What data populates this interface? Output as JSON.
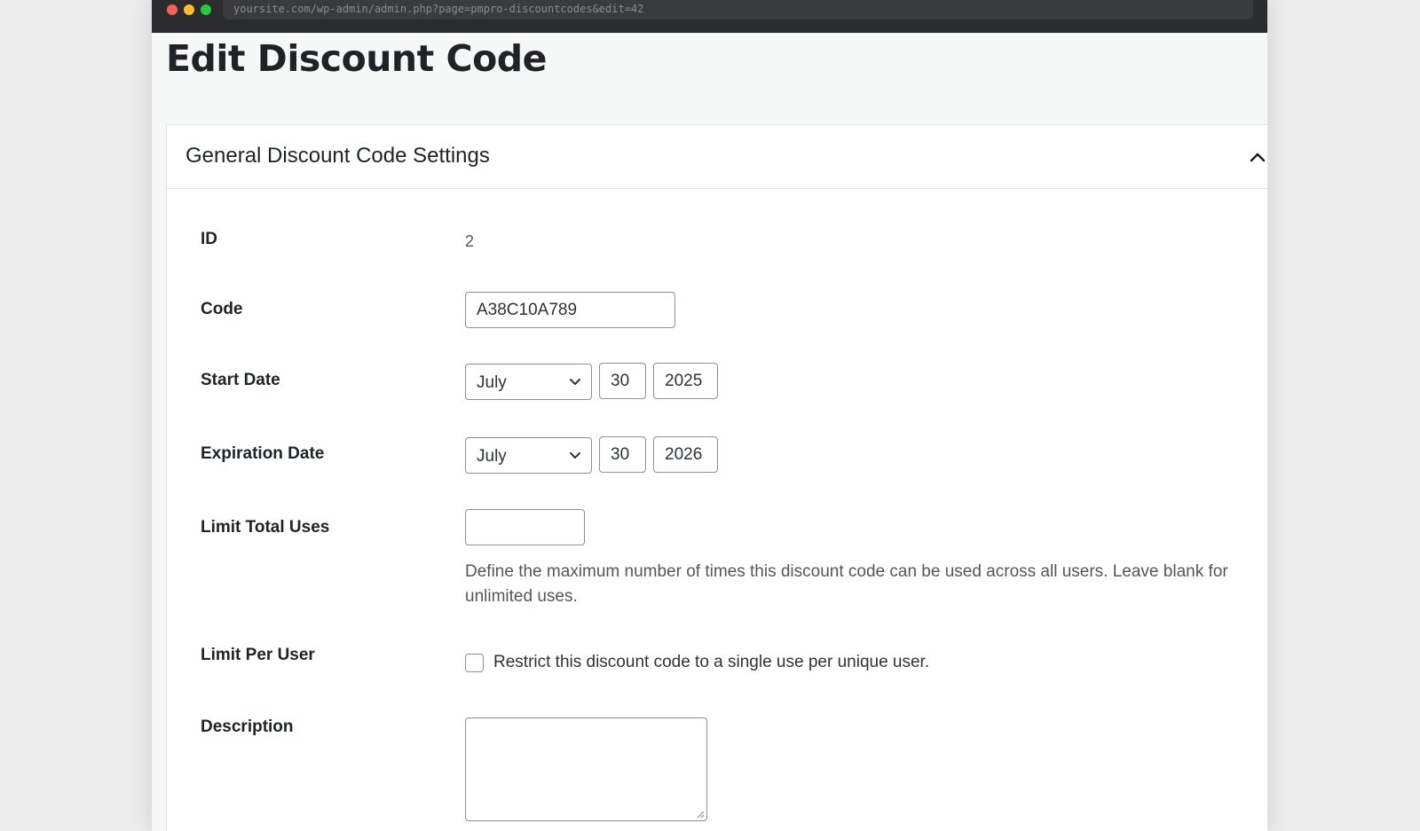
{
  "browser": {
    "url": "yoursite.com/wp-admin/admin.php?page=pmpro-discountcodes&edit=42"
  },
  "page": {
    "title": "Edit Discount Code"
  },
  "panel": {
    "title": "General Discount Code Settings",
    "collapse_icon": "chevron-up-icon"
  },
  "fields": {
    "id": {
      "label": "ID",
      "value": "2"
    },
    "code": {
      "label": "Code",
      "value": "A38C10A789"
    },
    "start_date": {
      "label": "Start Date",
      "month": "July",
      "day": "30",
      "year": "2025"
    },
    "expiration_date": {
      "label": "Expiration Date",
      "month": "July",
      "day": "30",
      "year": "2026"
    },
    "limit_total_uses": {
      "label": "Limit Total Uses",
      "value": "",
      "help": "Define the maximum number of times this discount code can be used across all users. Leave blank for unlimited uses."
    },
    "limit_per_user": {
      "label": "Limit Per User",
      "checked": false,
      "checkbox_label": "Restrict this discount code to a single use per unique user."
    },
    "description": {
      "label": "Description",
      "value": ""
    }
  },
  "colors": {
    "titlebar": "#2b2c2e",
    "page_background": "#f6f7f7",
    "text": "#1d2327",
    "border": "#8c8f94"
  }
}
